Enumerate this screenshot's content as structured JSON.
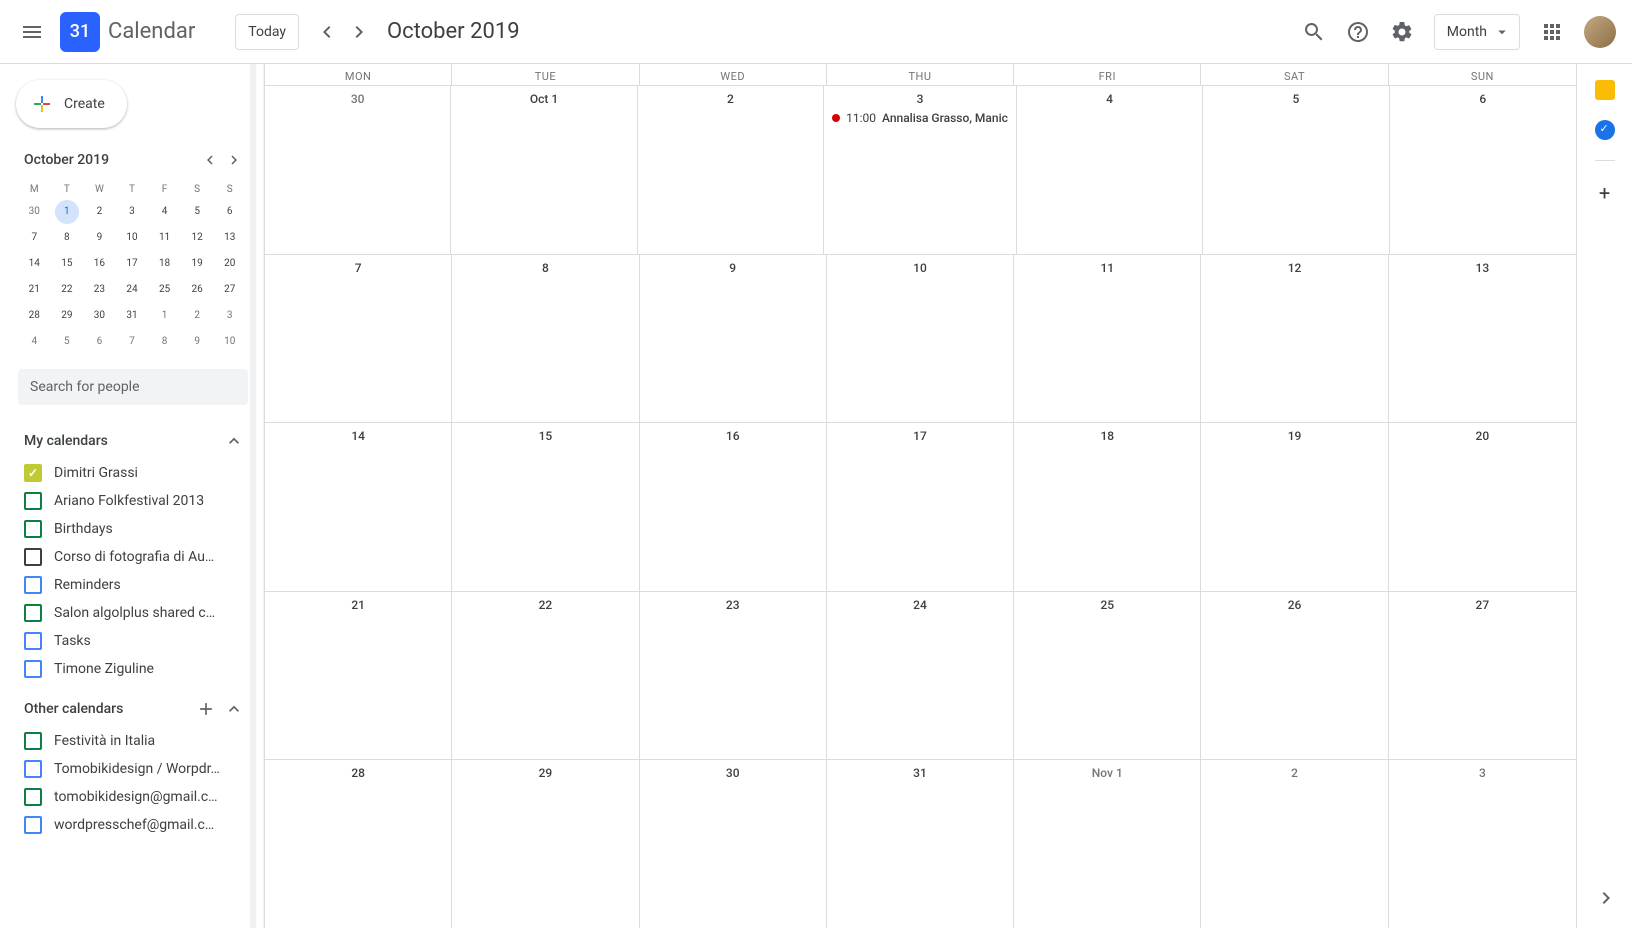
{
  "header": {
    "logo_day": "31",
    "app_title": "Calendar",
    "today_label": "Today",
    "month_title": "October 2019",
    "view_label": "Month"
  },
  "create_label": "Create",
  "mini": {
    "title": "October 2019",
    "dow": [
      "M",
      "T",
      "W",
      "T",
      "F",
      "S",
      "S"
    ],
    "days": [
      {
        "n": "30",
        "muted": true
      },
      {
        "n": "1",
        "today": true
      },
      {
        "n": "2"
      },
      {
        "n": "3"
      },
      {
        "n": "4"
      },
      {
        "n": "5"
      },
      {
        "n": "6"
      },
      {
        "n": "7"
      },
      {
        "n": "8"
      },
      {
        "n": "9"
      },
      {
        "n": "10"
      },
      {
        "n": "11"
      },
      {
        "n": "12"
      },
      {
        "n": "13"
      },
      {
        "n": "14"
      },
      {
        "n": "15"
      },
      {
        "n": "16"
      },
      {
        "n": "17"
      },
      {
        "n": "18"
      },
      {
        "n": "19"
      },
      {
        "n": "20"
      },
      {
        "n": "21"
      },
      {
        "n": "22"
      },
      {
        "n": "23"
      },
      {
        "n": "24"
      },
      {
        "n": "25"
      },
      {
        "n": "26"
      },
      {
        "n": "27"
      },
      {
        "n": "28"
      },
      {
        "n": "29"
      },
      {
        "n": "30"
      },
      {
        "n": "31"
      },
      {
        "n": "1",
        "muted": true
      },
      {
        "n": "2",
        "muted": true
      },
      {
        "n": "3",
        "muted": true
      },
      {
        "n": "4",
        "muted": true
      },
      {
        "n": "5",
        "muted": true
      },
      {
        "n": "6",
        "muted": true
      },
      {
        "n": "7",
        "muted": true
      },
      {
        "n": "8",
        "muted": true
      },
      {
        "n": "9",
        "muted": true
      },
      {
        "n": "10",
        "muted": true
      }
    ]
  },
  "search_placeholder": "Search for people",
  "my_calendars": {
    "title": "My calendars",
    "items": [
      {
        "label": "Dimitri Grassi",
        "color": "#c0ca33",
        "checked": true
      },
      {
        "label": "Ariano Folkfestival 2013",
        "color": "#0b8043",
        "checked": false
      },
      {
        "label": "Birthdays",
        "color": "#0b8043",
        "checked": false
      },
      {
        "label": "Corso di fotografia di Au…",
        "color": "#3c4043",
        "checked": false
      },
      {
        "label": "Reminders",
        "color": "#4285f4",
        "checked": false
      },
      {
        "label": "Salon algolplus shared c…",
        "color": "#0b8043",
        "checked": false
      },
      {
        "label": "Tasks",
        "color": "#4285f4",
        "checked": false
      },
      {
        "label": "Timone Ziguline",
        "color": "#4285f4",
        "checked": false
      }
    ]
  },
  "other_calendars": {
    "title": "Other calendars",
    "items": [
      {
        "label": "Festività in Italia",
        "color": "#0b8043",
        "checked": false
      },
      {
        "label": "Tomobikidesign / Worpdr…",
        "color": "#4285f4",
        "checked": false
      },
      {
        "label": "tomobikidesign@gmail.c…",
        "color": "#0b8043",
        "checked": false
      },
      {
        "label": "wordpresschef@gmail.c…",
        "color": "#4285f4",
        "checked": false
      }
    ]
  },
  "grid": {
    "dow": [
      "MON",
      "TUE",
      "WED",
      "THU",
      "FRI",
      "SAT",
      "SUN"
    ],
    "weeks": [
      [
        {
          "label": "30",
          "muted": true
        },
        {
          "label": "Oct 1"
        },
        {
          "label": "2"
        },
        {
          "label": "3",
          "events": [
            {
              "time": "11:00",
              "title": "Annalisa Grasso, Manic"
            }
          ]
        },
        {
          "label": "4"
        },
        {
          "label": "5"
        },
        {
          "label": "6"
        }
      ],
      [
        {
          "label": "7"
        },
        {
          "label": "8"
        },
        {
          "label": "9"
        },
        {
          "label": "10"
        },
        {
          "label": "11"
        },
        {
          "label": "12"
        },
        {
          "label": "13"
        }
      ],
      [
        {
          "label": "14"
        },
        {
          "label": "15"
        },
        {
          "label": "16"
        },
        {
          "label": "17"
        },
        {
          "label": "18"
        },
        {
          "label": "19"
        },
        {
          "label": "20"
        }
      ],
      [
        {
          "label": "21"
        },
        {
          "label": "22"
        },
        {
          "label": "23"
        },
        {
          "label": "24"
        },
        {
          "label": "25"
        },
        {
          "label": "26"
        },
        {
          "label": "27"
        }
      ],
      [
        {
          "label": "28"
        },
        {
          "label": "29"
        },
        {
          "label": "30"
        },
        {
          "label": "31"
        },
        {
          "label": "Nov 1",
          "muted": true
        },
        {
          "label": "2",
          "muted": true
        },
        {
          "label": "3",
          "muted": true
        }
      ]
    ]
  }
}
